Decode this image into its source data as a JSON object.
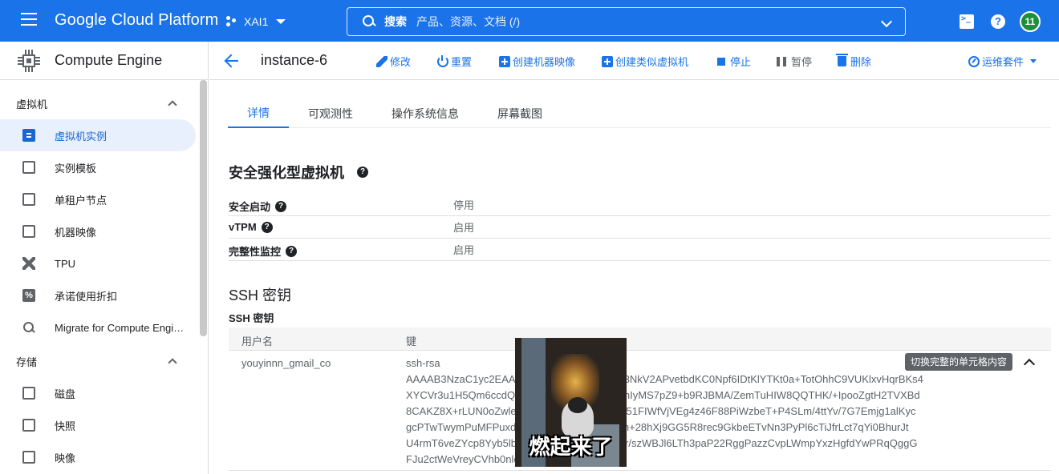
{
  "topbar": {
    "brand": "Google Cloud Platform",
    "project": "XAI1",
    "search_label": "搜索",
    "search_placeholder": "产品、资源、文档 (/)",
    "avatar_text": "11",
    "brand_color": "#1a73e8"
  },
  "sidebar": {
    "title": "Compute Engine",
    "section_vm": "虚拟机",
    "vm_items": [
      {
        "label": "虚拟机实例",
        "icon": "vm-instance-icon"
      },
      {
        "label": "实例模板",
        "icon": "template-icon"
      },
      {
        "label": "单租户节点",
        "icon": "sole-tenant-icon"
      },
      {
        "label": "机器映像",
        "icon": "machine-image-icon"
      },
      {
        "label": "TPU",
        "icon": "tpu-icon"
      },
      {
        "label": "承诺使用折扣",
        "icon": "percent-icon"
      },
      {
        "label": "Migrate for Compute Engi…",
        "icon": "search-icon"
      }
    ],
    "section_storage": "存储",
    "storage_items": [
      {
        "label": "磁盘",
        "icon": "disk-icon"
      },
      {
        "label": "快照",
        "icon": "snapshot-icon"
      },
      {
        "label": "映像",
        "icon": "image-icon"
      }
    ]
  },
  "toolbar": {
    "instance_name": "instance-6",
    "edit": "修改",
    "reset": "重置",
    "create_machine_image": "创建机器映像",
    "create_similar": "创建类似虚拟机",
    "stop": "停止",
    "suspend": "暂停",
    "delete": "删除",
    "ops_suite": "运维套件"
  },
  "tabs": [
    "详情",
    "可观测性",
    "操作系统信息",
    "屏幕截图"
  ],
  "shielded_vm": {
    "title": "安全强化型虚拟机",
    "rows": [
      {
        "key": "安全启动",
        "value": "停用"
      },
      {
        "key": "vTPM",
        "value": "启用"
      },
      {
        "key": "完整性监控",
        "value": "启用"
      }
    ]
  },
  "ssh": {
    "title": "SSH 密钥",
    "subtitle": "SSH 密钥",
    "col_user": "用户名",
    "col_key": "键",
    "user": "youyinnn_gmail_co",
    "key_lines": [
      "ssh-rsa",
      "AAAAB3NzaC1yc2EAAA                                      5Tz50BKTju36y89ZV3NkV2APvetbdKC0Npf6IDtKlYTKt0a+TotOhhC9VUKlxvHqrBKs4",
      "XYCVr3u1H5Qm6ccdQV                                      Nbq44sj8aa0wt5UzhthIyMS7pZ9+b9RJBMA/ZemTuHIW8QQTHK/+IpooZgtH2TVXBd",
      "8CAKZ8X+rLUN0oZwle                                      N0XTL7E8Uu8C+IVXZ51FIWfVjVEg4z46F88PiWzbeT+P4SLm/4ttYv/7G7Emjg1alKyc",
      "gcPTwTwymPuMFPuxd                                       vRmNMlJp8MyWH1/Uh+28hXj9GG5R8rec9GkbeETvNn3PyPl6cTiJfrLct7qYi0BhurJt",
      "U4rmT6veZYcp8Yyb5lb                                     x5MMjavrzaoPnn4WiXr/szWBJl6LTh3paP22RggPazzCvpLWmpYxzHgfdYwPRqQggG",
      "FJu2ctWeVreyCVhb0nle                                    o"
    ],
    "tooltip": "切换完整的单元格内容"
  },
  "overlay": {
    "caption": "燃起来了"
  }
}
